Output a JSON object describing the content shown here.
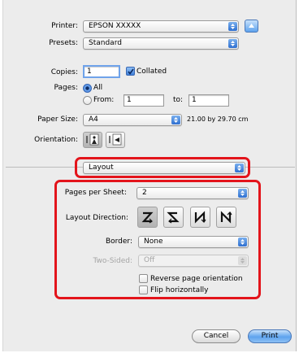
{
  "printer": {
    "label": "Printer:",
    "value": "EPSON XXXXX"
  },
  "presets": {
    "label": "Presets:",
    "value": "Standard"
  },
  "copies": {
    "label": "Copies:",
    "value": "1",
    "collated_label": "Collated",
    "collated_checked": true
  },
  "pages": {
    "label": "Pages:",
    "all_label": "All",
    "from_label": "From:",
    "from_value": "1",
    "to_label": "to:",
    "to_value": "1",
    "selected": "All"
  },
  "paper_size": {
    "label": "Paper Size:",
    "value": "A4",
    "dimensions": "21.00 by 29.70 cm"
  },
  "orientation": {
    "label": "Orientation:",
    "selected": "portrait"
  },
  "section_popup": {
    "value": "Layout"
  },
  "layout": {
    "pages_per_sheet": {
      "label": "Pages per Sheet:",
      "value": "2"
    },
    "layout_direction": {
      "label": "Layout Direction:",
      "options": [
        "Z",
        "S",
        "N-reverse",
        "N"
      ],
      "selected": 0
    },
    "border": {
      "label": "Border:",
      "value": "None"
    },
    "two_sided": {
      "label": "Two-Sided:",
      "value": "Off"
    },
    "reverse_orientation": {
      "label": "Reverse page orientation",
      "checked": false
    },
    "flip_horizontally": {
      "label": "Flip horizontally",
      "checked": false
    }
  },
  "buttons": {
    "cancel": "Cancel",
    "print": "Print"
  },
  "colors": {
    "highlight_border": "#e3141b",
    "accent": "#3978d6"
  }
}
